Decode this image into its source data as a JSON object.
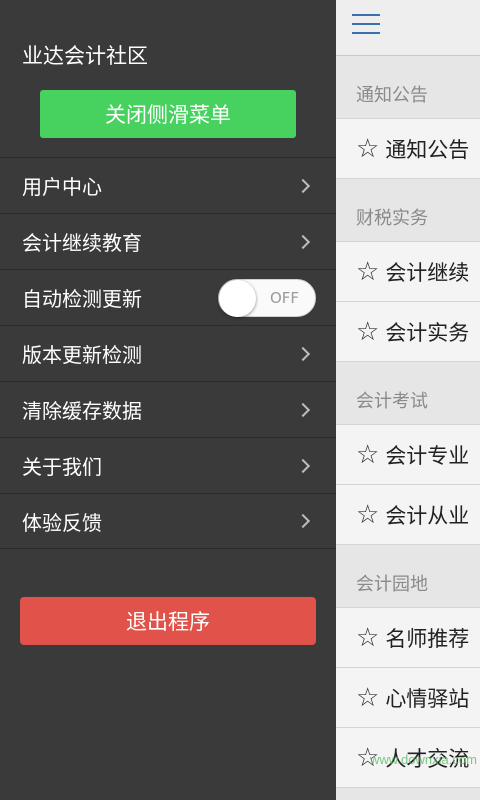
{
  "drawer": {
    "title": "业达会计社区",
    "close_button": "关闭侧滑菜单",
    "menu": [
      {
        "label": "用户中心",
        "type": "link"
      },
      {
        "label": "会计继续教育",
        "type": "link"
      },
      {
        "label": "自动检测更新",
        "type": "toggle",
        "toggle_text": "OFF"
      },
      {
        "label": "版本更新检测",
        "type": "link"
      },
      {
        "label": "清除缓存数据",
        "type": "link"
      },
      {
        "label": "关于我们",
        "type": "link"
      },
      {
        "label": "体验反馈",
        "type": "link"
      }
    ],
    "exit_button": "退出程序"
  },
  "main": {
    "sections": [
      {
        "header": "通知公告",
        "items": [
          "通知公告"
        ]
      },
      {
        "header": "财税实务",
        "items": [
          "会计继续",
          "会计实务"
        ]
      },
      {
        "header": "会计考试",
        "items": [
          "会计专业",
          "会计从业"
        ]
      },
      {
        "header": "会计园地",
        "items": [
          "名师推荐",
          "心情驿站",
          "人才交流"
        ]
      }
    ],
    "star_glyph": "☆"
  },
  "watermark": "www.downxia.com",
  "colors": {
    "drawer_bg": "#3a3a3a",
    "close_button": "#47d25f",
    "exit_button": "#e0524a",
    "hamburger": "#3b6fb0"
  }
}
